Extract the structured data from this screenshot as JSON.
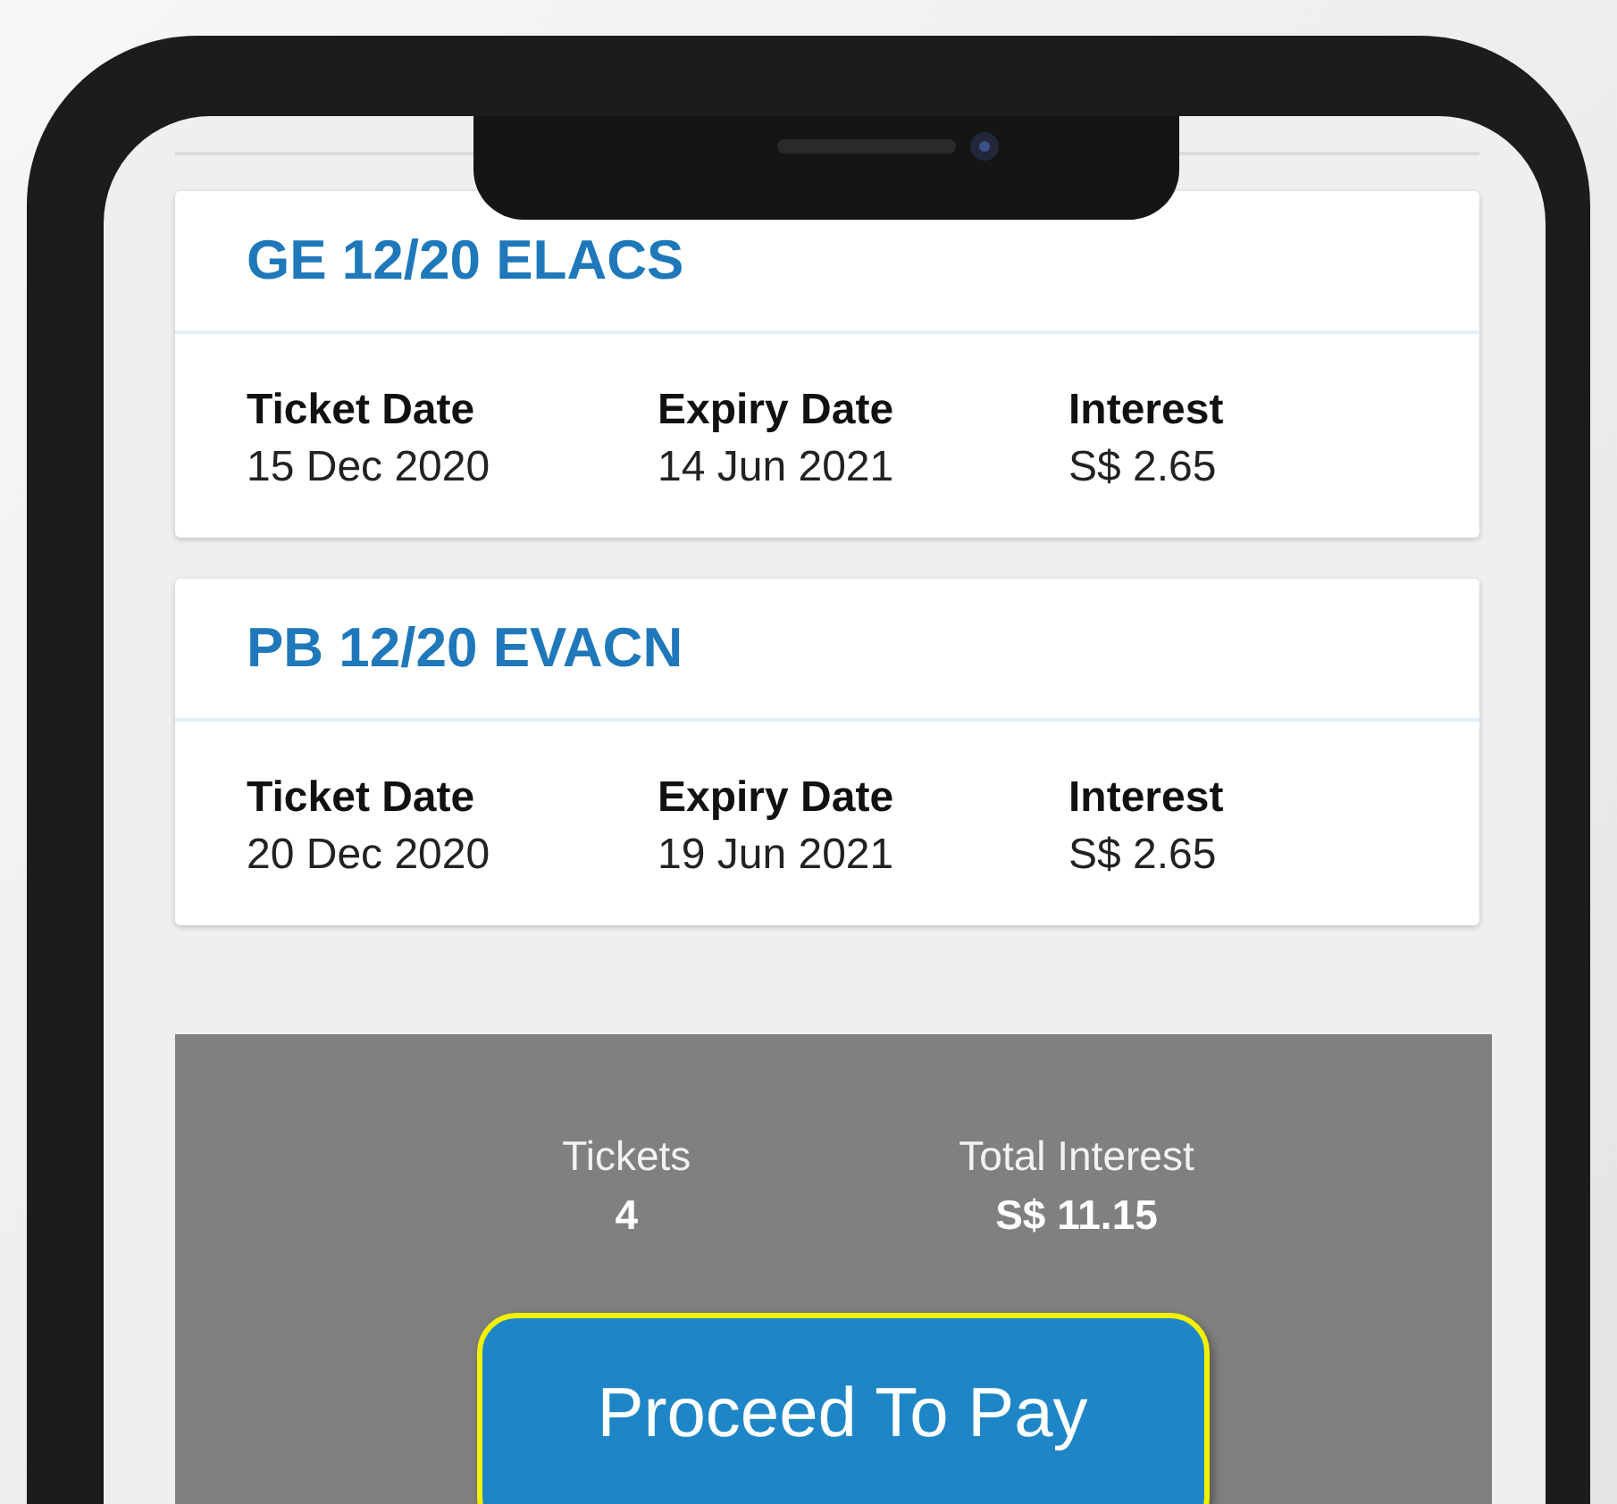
{
  "tickets": [
    {
      "title": "GE 12/20 ELACS",
      "fields": [
        {
          "label": "Ticket Date",
          "value": "15 Dec 2020"
        },
        {
          "label": "Expiry Date",
          "value": "14 Jun 2021"
        },
        {
          "label": "Interest",
          "value": "S$ 2.65"
        }
      ]
    },
    {
      "title": "PB 12/20 EVACN",
      "fields": [
        {
          "label": "Ticket Date",
          "value": "20 Dec 2020"
        },
        {
          "label": "Expiry Date",
          "value": "19 Jun 2021"
        },
        {
          "label": "Interest",
          "value": "S$ 2.65"
        }
      ]
    }
  ],
  "summary": {
    "items": [
      {
        "label": "Tickets",
        "value": "4"
      },
      {
        "label": "Total Interest",
        "value": "S$ 11.15"
      }
    ],
    "button": "Proceed To Pay"
  }
}
